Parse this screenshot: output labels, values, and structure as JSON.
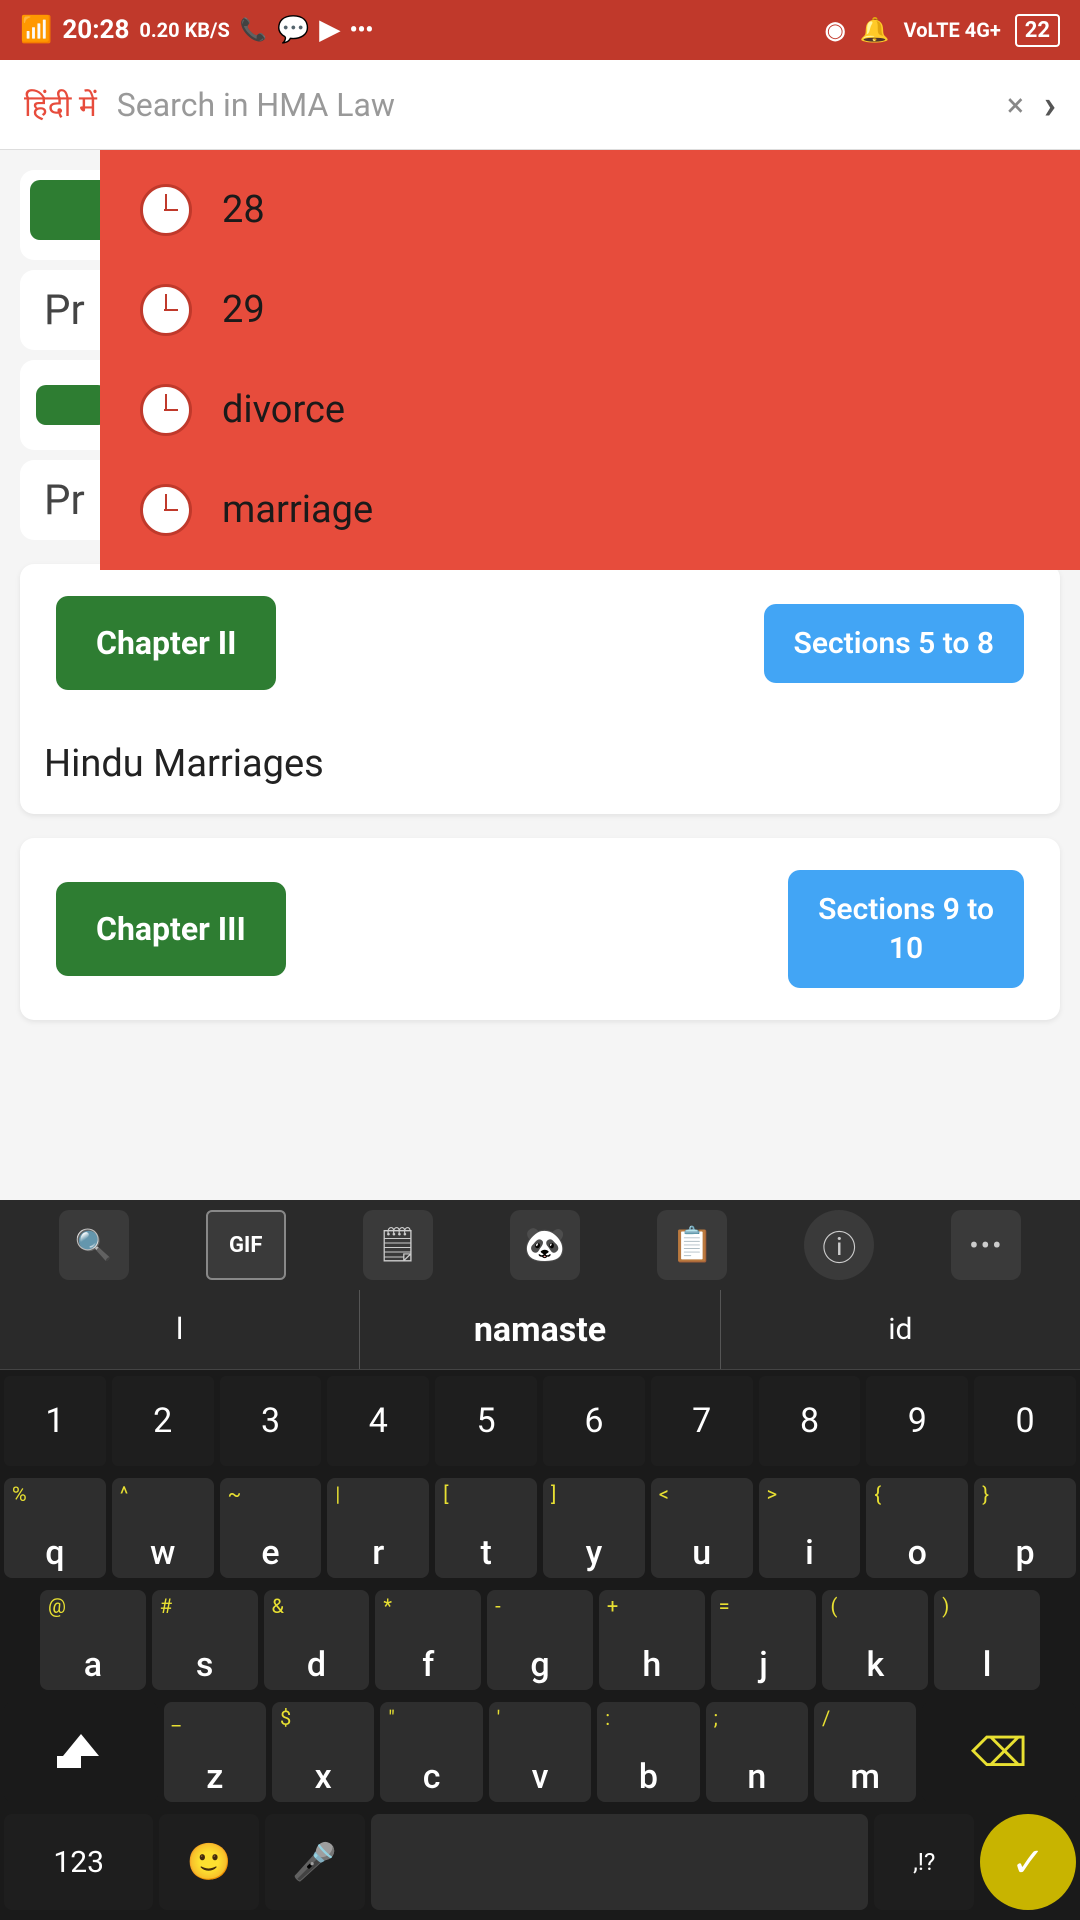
{
  "statusBar": {
    "signal": "4G+",
    "time": "20:28",
    "speed": "0.20 KB/S",
    "battery": "22"
  },
  "searchBar": {
    "hindiLabel": "हिंदी में",
    "placeholder": "Search in HMA Law",
    "clearBtn": "×",
    "goBtn": "›"
  },
  "dropdown": {
    "items": [
      {
        "id": "item-28",
        "text": "28"
      },
      {
        "id": "item-29",
        "text": "29"
      },
      {
        "id": "item-divorce",
        "text": "divorce"
      },
      {
        "id": "item-marriage",
        "text": "marriage"
      }
    ]
  },
  "chapters": [
    {
      "id": "chapter-ii",
      "chapterLabel": "Chapter II",
      "sectionsLabel": "Sections 5 to 8",
      "title": "Hindu Marriages"
    },
    {
      "id": "chapter-iii",
      "chapterLabel": "Chapter III",
      "sectionsLabel": "Sections 9 to\n10",
      "title": ""
    }
  ],
  "keyboard": {
    "suggestions": {
      "left": "l",
      "middle": "namaste",
      "right": "id"
    },
    "rows": {
      "numbers": [
        "1",
        "2",
        "3",
        "4",
        "5",
        "6",
        "7",
        "8",
        "9",
        "0"
      ],
      "row1": {
        "keys": [
          "q",
          "w",
          "e",
          "r",
          "t",
          "y",
          "u",
          "i",
          "o",
          "p"
        ],
        "alts": [
          "%",
          "^",
          "~",
          "|",
          "[",
          "]",
          "<",
          ">{",
          "}"
        ]
      },
      "row2": {
        "keys": [
          "a",
          "s",
          "d",
          "f",
          "g",
          "h",
          "j",
          "k",
          "l"
        ],
        "alts": [
          "@",
          "#",
          "&",
          "*",
          "-",
          "+",
          "=",
          "(",
          ")"
        ]
      },
      "row3": {
        "keys": [
          "z",
          "x",
          "c",
          "v",
          "b",
          "n",
          "m"
        ],
        "alts": [
          "_",
          "$",
          "\"",
          "'",
          ":",
          ";",
          "/"
        ]
      }
    },
    "bottomRow": {
      "num": "123",
      "comma": ",",
      "space": " ",
      "period": ".",
      "punctuation": ",!?"
    }
  }
}
